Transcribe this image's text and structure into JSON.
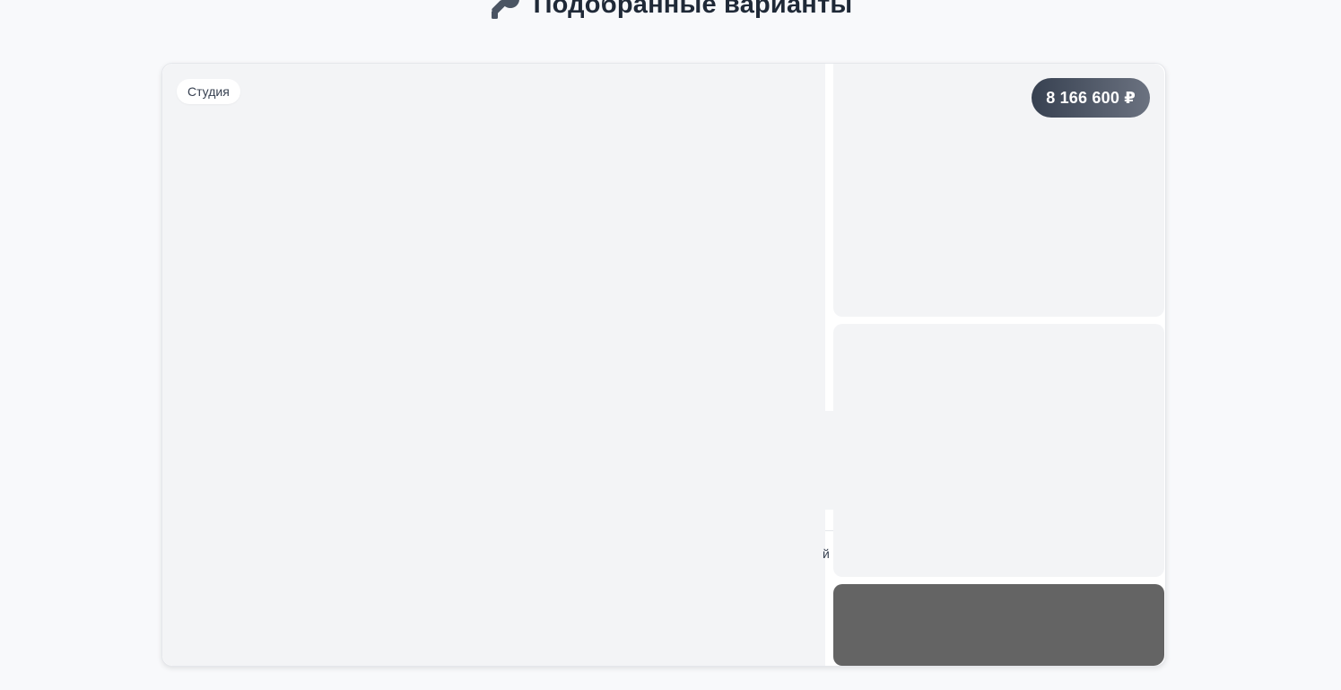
{
  "header": {
    "title": "Подобранные варианты",
    "icon": "key-icon"
  },
  "listing": {
    "type_label": "Студия",
    "price": "8 166 600 ₽",
    "partial_text": "й",
    "thumbnails": 3
  },
  "colors": {
    "price_gradient_start": "#374151",
    "price_gradient_end": "#6b7280",
    "photo_placeholder": "#f3f4f6",
    "dark_thumbnail": "#646464",
    "title": "#1f2937"
  }
}
